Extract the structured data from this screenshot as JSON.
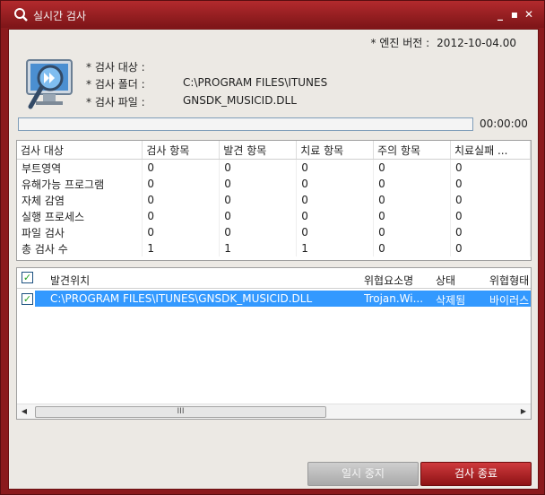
{
  "window": {
    "title": "실시간 검사",
    "controls": [
      "minimize",
      "maximize",
      "close"
    ]
  },
  "engine": {
    "label": "* 엔진 버전 :",
    "value": "2012-10-04.00"
  },
  "scan_info": [
    {
      "label": "* 검사 대상 :",
      "value": ""
    },
    {
      "label": "* 검사 폴더 :",
      "value": "C:\\PROGRAM FILES\\ITUNES"
    },
    {
      "label": "* 검사 파일 :",
      "value": "GNSDK_MUSICID.DLL"
    }
  ],
  "progress": {
    "percent": 0,
    "time": "00:00:00"
  },
  "stats": {
    "headers": [
      "검사 대상",
      "검사 항목",
      "발견 항목",
      "치료 항목",
      "주의 항목",
      "치료실패 ..."
    ],
    "rows": [
      [
        "부트영역",
        "0",
        "0",
        "0",
        "0",
        "0"
      ],
      [
        "유해가능 프로그램",
        "0",
        "0",
        "0",
        "0",
        "0"
      ],
      [
        "자체 감염",
        "0",
        "0",
        "0",
        "0",
        "0"
      ],
      [
        "실행 프로세스",
        "0",
        "0",
        "0",
        "0",
        "0"
      ],
      [
        "파일 검사",
        "0",
        "0",
        "0",
        "0",
        "0"
      ],
      [
        "총 검사 수",
        "1",
        "1",
        "1",
        "0",
        "0"
      ]
    ]
  },
  "detections": {
    "headers": [
      "발견위치",
      "위협요소명",
      "상태",
      "위협형태"
    ],
    "rows": [
      {
        "checked": true,
        "location": "C:\\PROGRAM FILES\\ITUNES\\GNSDK_MUSICID.DLL",
        "threat": "Trojan.Wi...",
        "status": "삭제됨",
        "type": "바이러스"
      }
    ],
    "scroll_thumb_label": "III"
  },
  "buttons": {
    "pause": "일시 중지",
    "end": "검사 종료"
  },
  "colors": {
    "frame": "#8b1a1d",
    "selection": "#3399ff",
    "end_button": "#b0272a"
  }
}
